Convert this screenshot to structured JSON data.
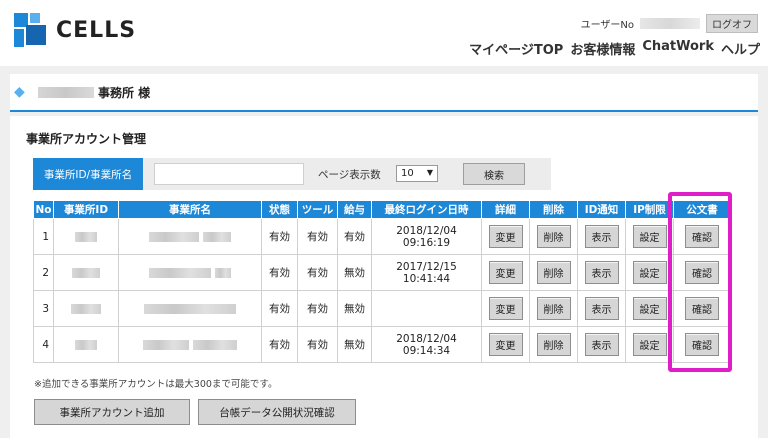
{
  "header": {
    "logo_text": "CELLS",
    "user_label": "ユーザーNo",
    "logout_label": "ログオフ",
    "nav": [
      "マイページTOP",
      "お客様情報",
      "ChatWork",
      "ヘルプ"
    ]
  },
  "office": {
    "suffix": "事務所 様"
  },
  "section": {
    "title": "事業所アカウント管理"
  },
  "search": {
    "tab_label": "事業所ID/事業所名",
    "input_value": "",
    "per_page_label": "ページ表示数",
    "per_page_value": "10",
    "search_button": "検索"
  },
  "table": {
    "headers": [
      "No",
      "事業所ID",
      "事業所名",
      "状態",
      "ツール",
      "給与",
      "最終ログイン日時",
      "詳細",
      "削除",
      "ID通知",
      "IP制限",
      "公文書"
    ],
    "rows": [
      {
        "no": "1",
        "status": "有効",
        "tool": "有効",
        "salary": "有効",
        "last_login": "2018/12/04 09:16:19",
        "detail": "変更",
        "delete": "削除",
        "id_notify": "表示",
        "ip_limit": "設定",
        "document": "確認"
      },
      {
        "no": "2",
        "status": "有効",
        "tool": "有効",
        "salary": "無効",
        "last_login": "2017/12/15 10:41:44",
        "detail": "変更",
        "delete": "削除",
        "id_notify": "表示",
        "ip_limit": "設定",
        "document": "確認"
      },
      {
        "no": "3",
        "status": "有効",
        "tool": "有効",
        "salary": "無効",
        "last_login": "",
        "detail": "変更",
        "delete": "削除",
        "id_notify": "表示",
        "ip_limit": "設定",
        "document": "確認"
      },
      {
        "no": "4",
        "status": "有効",
        "tool": "有効",
        "salary": "無効",
        "last_login": "2018/12/04 09:14:34",
        "detail": "変更",
        "delete": "削除",
        "id_notify": "表示",
        "ip_limit": "設定",
        "document": "確認"
      }
    ]
  },
  "note": "※追加できる事業所アカウントは最大300まで可能です。",
  "actions": {
    "add_account": "事業所アカウント追加",
    "ledger_check": "台帳データ公開状況確認"
  },
  "colors": {
    "accent": "#1e88d8",
    "highlight": "#e01ec8",
    "status_text": "#1a4fb0"
  }
}
